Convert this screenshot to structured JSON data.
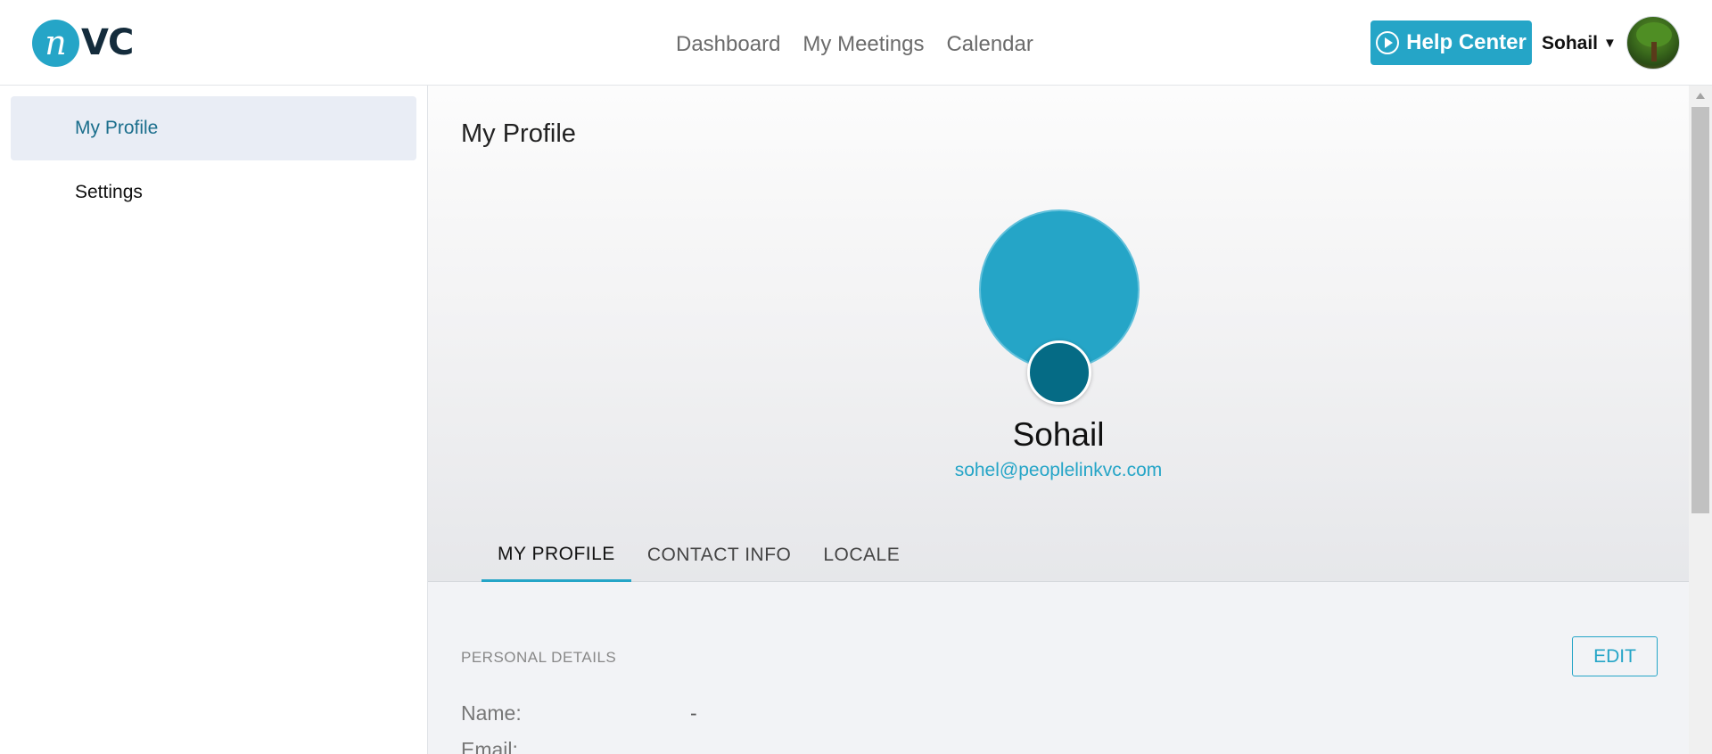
{
  "logo": {
    "mark": "n",
    "text": "VC"
  },
  "nav": {
    "items": [
      {
        "label": "Dashboard"
      },
      {
        "label": "My Meetings"
      },
      {
        "label": "Calendar"
      }
    ]
  },
  "header": {
    "help_label": "Help Center",
    "user_name": "Sohail",
    "caret": "▼"
  },
  "sidebar": {
    "items": [
      {
        "label": "My Profile",
        "active": true
      },
      {
        "label": "Settings",
        "active": false
      }
    ]
  },
  "main": {
    "title": "My Profile",
    "profile": {
      "name": "Sohail",
      "email": "sohel@peoplelinkvc.com"
    },
    "tabs": [
      {
        "label": "MY PROFILE",
        "active": true
      },
      {
        "label": "CONTACT INFO",
        "active": false
      },
      {
        "label": "LOCALE",
        "active": false
      }
    ],
    "section": {
      "title": "PERSONAL DETAILS",
      "edit_label": "EDIT",
      "fields": [
        {
          "label": "Name:",
          "value": "-"
        },
        {
          "label": "Email:",
          "value": ""
        }
      ]
    }
  },
  "colors": {
    "accent": "#25a5c7",
    "accent_dark": "#056b85",
    "sidebar_active_bg": "#e9edf5"
  },
  "icons": {
    "help": "play-circle-icon",
    "user_caret": "caret-down-icon",
    "scroll_up": "scroll-up-arrow-icon"
  }
}
